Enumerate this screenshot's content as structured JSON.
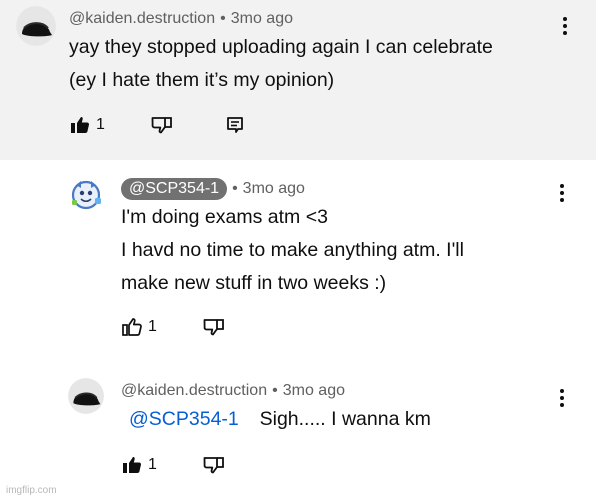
{
  "comments": [
    {
      "author": "@kaiden.destruction",
      "separator": "•",
      "time": "3mo ago",
      "lines": [
        "yay they stopped uploading again I can celebrate",
        "(ey I hate them it’s my opinion)"
      ],
      "likes": "1",
      "liked": true,
      "avatar_icon": "black-cap-icon",
      "actions": [
        "like-icon",
        "dislike-icon",
        "reply-icon",
        "more-vert-icon"
      ]
    },
    {
      "author": "@SCP354-1",
      "is_creator": true,
      "separator": "•",
      "time": "3mo ago",
      "lines": [
        "I'm doing exams atm <3",
        "I havd no time to make anything atm. I'll",
        "make new stuff in two weeks :)"
      ],
      "likes": "1",
      "liked": false,
      "avatar_icon": "cartoon-mascot-icon",
      "actions": [
        "like-icon",
        "dislike-icon",
        "more-vert-icon"
      ]
    },
    {
      "author": "@kaiden.destruction",
      "separator": "•",
      "time": "3mo ago",
      "mention": "@SCP354-1",
      "text": "Sigh..... I wanna km",
      "likes": "1",
      "liked": true,
      "avatar_icon": "black-cap-icon",
      "actions": [
        "like-icon",
        "dislike-icon",
        "more-vert-icon"
      ]
    }
  ],
  "watermark": "imgflip.com",
  "colors": {
    "highlight_bg": "#f2f2f2",
    "text": "#0f0f0f",
    "meta": "#606060",
    "mention": "#065fd4",
    "creator_chip": "#717171"
  }
}
